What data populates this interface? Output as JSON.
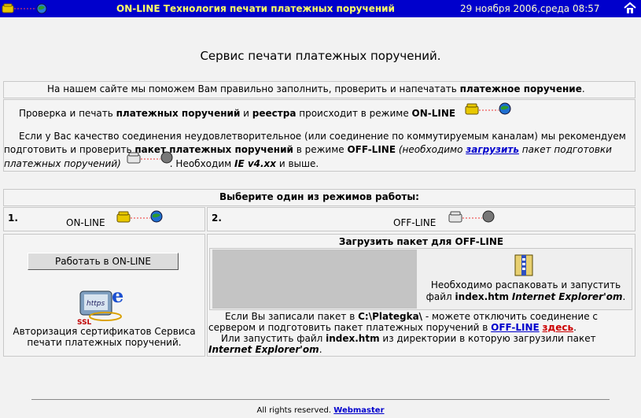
{
  "header": {
    "title": "ON-LINE Технология печати платежных поручений",
    "date": "29 ноября 2006,среда 08:57"
  },
  "headline": "Сервис печати платежных поручений.",
  "intro": {
    "text_a": "На нашем сайте мы поможем Вам правильно заполнить, проверить и напечатать ",
    "text_b": "платежное поручение",
    "text_c": "."
  },
  "info": {
    "l1_a": "Проверка и печать ",
    "l1_b": "платежных поручений",
    "l1_c": " и ",
    "l1_d": "реестра",
    "l1_e": " происходит в режиме ",
    "l1_f": "ON-LINE",
    "l2_a": "Если у Вас качество соединения неудовлетворительное (или соединение по коммутируемым каналам) мы рекомендуем",
    "l3_a": "подготовить и проверить ",
    "l3_b": "пакет платежных поручений",
    "l3_c": " в режиме ",
    "l3_d": "OFF-LINE",
    "l3_e": " (необходимо ",
    "l3_link": "загрузить",
    "l3_f": " пакет подготовки",
    "l4_a": "платежных поручений)",
    "l4_b": ". Необходим ",
    "l4_c": "IE v4.xx",
    "l4_d": " и выше."
  },
  "modes": {
    "heading": "Выберите один из режимов работы:",
    "online_num": "1.",
    "online_label": "ON-LINE",
    "offline_num": "2.",
    "offline_label": "OFF-LINE"
  },
  "online_panel": {
    "button": "Работать в ON-LINE",
    "cert_text_1": "Авторизация сертификатов Сервиса",
    "cert_text_2": "печати платежных поручений."
  },
  "offline_panel": {
    "heading": "Загрузить пакет для OFF-LINE",
    "unpack_1": "Необходимо распаковать и запустить",
    "unpack_2a": "файл ",
    "unpack_2b": "index.htm",
    "unpack_2c": "Internet Explorer'om",
    "unpack_2d": ".",
    "note_1a": "Если Вы записали пакет в ",
    "note_1b": "C:\\Plategka\\",
    "note_1c": " - можете отключить соединение с",
    "note_2a": "сервером и подготовить пакет платежных поручений в ",
    "note_2b": "OFF-LINE",
    "note_2c": "здесь",
    "note_2d": ".",
    "note_3a": "Или запустить файл ",
    "note_3b": "index.htm",
    "note_3c": " из директории в которую загрузили пакет",
    "note_4": "Internet Explorer'om",
    "note_4b": "."
  },
  "footer": {
    "text": "All rights reserved.",
    "link": "Webmaster"
  },
  "colors": {
    "topbar": "#0000cc",
    "link": "#0000cc",
    "here_link": "#cc0000"
  }
}
